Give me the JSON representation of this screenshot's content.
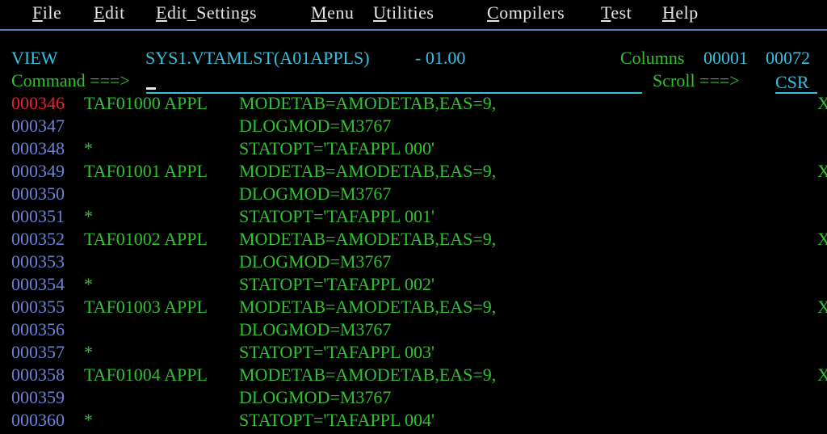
{
  "menu": {
    "items": [
      {
        "mnemonic": "F",
        "rest": "ile"
      },
      {
        "mnemonic": "E",
        "rest": "dit"
      },
      {
        "mnemonic": "E",
        "rest": "dit_Settings"
      },
      {
        "mnemonic": "M",
        "rest": "enu"
      },
      {
        "mnemonic": "U",
        "rest": "tilities"
      },
      {
        "mnemonic": "C",
        "rest": "ompilers"
      },
      {
        "mnemonic": "T",
        "rest": "est"
      },
      {
        "mnemonic": "H",
        "rest": "elp"
      }
    ]
  },
  "header": {
    "mode": "VIEW",
    "dataset": "SYS1.VTAMLST(A01APPLS)",
    "version": "- 01.00",
    "columns_label": "Columns",
    "columns_from": "00001",
    "columns_to": "00072",
    "command_label": "Command ===>",
    "command_value": "",
    "scroll_label": "Scroll ===>",
    "scroll_value": "CSR"
  },
  "colors": {
    "background": "#000000",
    "menu_text": "#e6e6e6",
    "separator": "#5d7fc0",
    "header_cyan": "#36c0e0",
    "text_green": "#2fc22f",
    "line_number_blue": "#6c82d8",
    "current_line_red": "#e8202a"
  },
  "lines": [
    {
      "num": "000346",
      "label": "TAF01000 APPL",
      "stmt": "MODETAB=AMODETAB,EAS=9,",
      "cont": "X",
      "current": true
    },
    {
      "num": "000347",
      "label": "",
      "stmt": "DLOGMOD=M3767",
      "cont": ""
    },
    {
      "num": "000348",
      "label": "*",
      "stmt": "STATOPT='TAFAPPL 000'",
      "cont": ""
    },
    {
      "num": "000349",
      "label": "TAF01001 APPL",
      "stmt": "MODETAB=AMODETAB,EAS=9,",
      "cont": "X"
    },
    {
      "num": "000350",
      "label": "",
      "stmt": "DLOGMOD=M3767",
      "cont": ""
    },
    {
      "num": "000351",
      "label": "*",
      "stmt": "STATOPT='TAFAPPL 001'",
      "cont": ""
    },
    {
      "num": "000352",
      "label": "TAF01002 APPL",
      "stmt": "MODETAB=AMODETAB,EAS=9,",
      "cont": "X"
    },
    {
      "num": "000353",
      "label": "",
      "stmt": "DLOGMOD=M3767",
      "cont": ""
    },
    {
      "num": "000354",
      "label": "*",
      "stmt": "STATOPT='TAFAPPL 002'",
      "cont": ""
    },
    {
      "num": "000355",
      "label": "TAF01003 APPL",
      "stmt": "MODETAB=AMODETAB,EAS=9,",
      "cont": "X"
    },
    {
      "num": "000356",
      "label": "",
      "stmt": "DLOGMOD=M3767",
      "cont": ""
    },
    {
      "num": "000357",
      "label": "*",
      "stmt": "STATOPT='TAFAPPL 003'",
      "cont": ""
    },
    {
      "num": "000358",
      "label": "TAF01004 APPL",
      "stmt": "MODETAB=AMODETAB,EAS=9,",
      "cont": "X"
    },
    {
      "num": "000359",
      "label": "",
      "stmt": "DLOGMOD=M3767",
      "cont": ""
    },
    {
      "num": "000360",
      "label": "*",
      "stmt": "STATOPT='TAFAPPL 004'",
      "cont": ""
    }
  ]
}
